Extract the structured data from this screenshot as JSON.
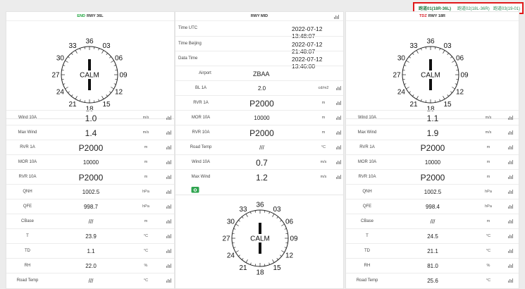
{
  "tabs": [
    {
      "label": "跑道01(18R-36L)"
    },
    {
      "label": "跑道02(18L-36R)"
    },
    {
      "label": "跑道03(19-01)"
    }
  ],
  "left": {
    "tag": "END",
    "title": "RWY 36L",
    "compass": {
      "center": "CALM",
      "labels": [
        "36",
        "03",
        "06",
        "09",
        "12",
        "15",
        "18",
        "21",
        "24",
        "27",
        "30",
        "33"
      ]
    },
    "rows": [
      {
        "label": "Wind 10A",
        "value": "1.0",
        "unit": "m/s"
      },
      {
        "label": "Max Wind",
        "value": "1.4",
        "unit": "m/s"
      },
      {
        "label": "RVR 1A",
        "value": "P2000",
        "unit": "m"
      },
      {
        "label": "MOR 10A",
        "value": "10000",
        "unit": "m"
      },
      {
        "label": "RVR 10A",
        "value": "P2000",
        "unit": "m"
      },
      {
        "label": "QNH",
        "value": "1002.5",
        "unit": "hPa"
      },
      {
        "label": "QFE",
        "value": "998.7",
        "unit": "hPa"
      },
      {
        "label": "CBase",
        "value": "///",
        "unit": "m"
      },
      {
        "label": "T",
        "value": "23.9",
        "unit": "°C"
      },
      {
        "label": "TD",
        "value": "1.1",
        "unit": "°C"
      },
      {
        "label": "RH",
        "value": "22.0",
        "unit": "%"
      },
      {
        "label": "Road Temp",
        "value": "///",
        "unit": "°C"
      }
    ]
  },
  "mid": {
    "title": "RWY MID",
    "info": [
      {
        "label": "Time UTC",
        "value": "2022-07-12 13:48:07"
      },
      {
        "label": "Time Beijing",
        "value": "2022-07-12 21:48:07"
      },
      {
        "label": "Data Time",
        "value": "2022-07-12 13:46:00"
      }
    ],
    "airport": {
      "label": "Airport",
      "value": "ZBAA"
    },
    "rows": [
      {
        "label": "BL 1A",
        "value": "2.0",
        "unit": "cd/m2"
      },
      {
        "label": "RVR 1A",
        "value": "P2000",
        "unit": "m"
      },
      {
        "label": "MOR 10A",
        "value": "10000",
        "unit": "m"
      },
      {
        "label": "RVR 10A",
        "value": "P2000",
        "unit": "m"
      },
      {
        "label": "Road Temp",
        "value": "///",
        "unit": "°C"
      },
      {
        "label": "Wind 10A",
        "value": "0.7",
        "unit": "m/s"
      },
      {
        "label": "Max Wind",
        "value": "1.2",
        "unit": "m/s"
      }
    ],
    "compass": {
      "center": "CALM",
      "labels": [
        "36",
        "03",
        "06",
        "09",
        "12",
        "15",
        "18",
        "21",
        "24",
        "27",
        "30",
        "33"
      ]
    }
  },
  "right": {
    "tag": "TDZ",
    "title": "RWY 18R",
    "compass": {
      "center": "CALM",
      "labels": [
        "36",
        "03",
        "06",
        "09",
        "12",
        "15",
        "18",
        "21",
        "24",
        "27",
        "30",
        "33"
      ]
    },
    "rows": [
      {
        "label": "Wind 10A",
        "value": "1.1",
        "unit": "m/s"
      },
      {
        "label": "Max Wind",
        "value": "1.9",
        "unit": "m/s"
      },
      {
        "label": "RVR 1A",
        "value": "P2000",
        "unit": "m"
      },
      {
        "label": "MOR 10A",
        "value": "10000",
        "unit": "m"
      },
      {
        "label": "RVR 10A",
        "value": "P2000",
        "unit": "m"
      },
      {
        "label": "QNH",
        "value": "1002.5",
        "unit": "hPa"
      },
      {
        "label": "QFE",
        "value": "998.4",
        "unit": "hPa"
      },
      {
        "label": "CBase",
        "value": "///",
        "unit": "m"
      },
      {
        "label": "T",
        "value": "24.5",
        "unit": "°C"
      },
      {
        "label": "TD",
        "value": "21.1",
        "unit": "°C"
      },
      {
        "label": "RH",
        "value": "81.0",
        "unit": "%"
      },
      {
        "label": "Road Temp",
        "value": "25.6",
        "unit": "°C"
      }
    ]
  }
}
